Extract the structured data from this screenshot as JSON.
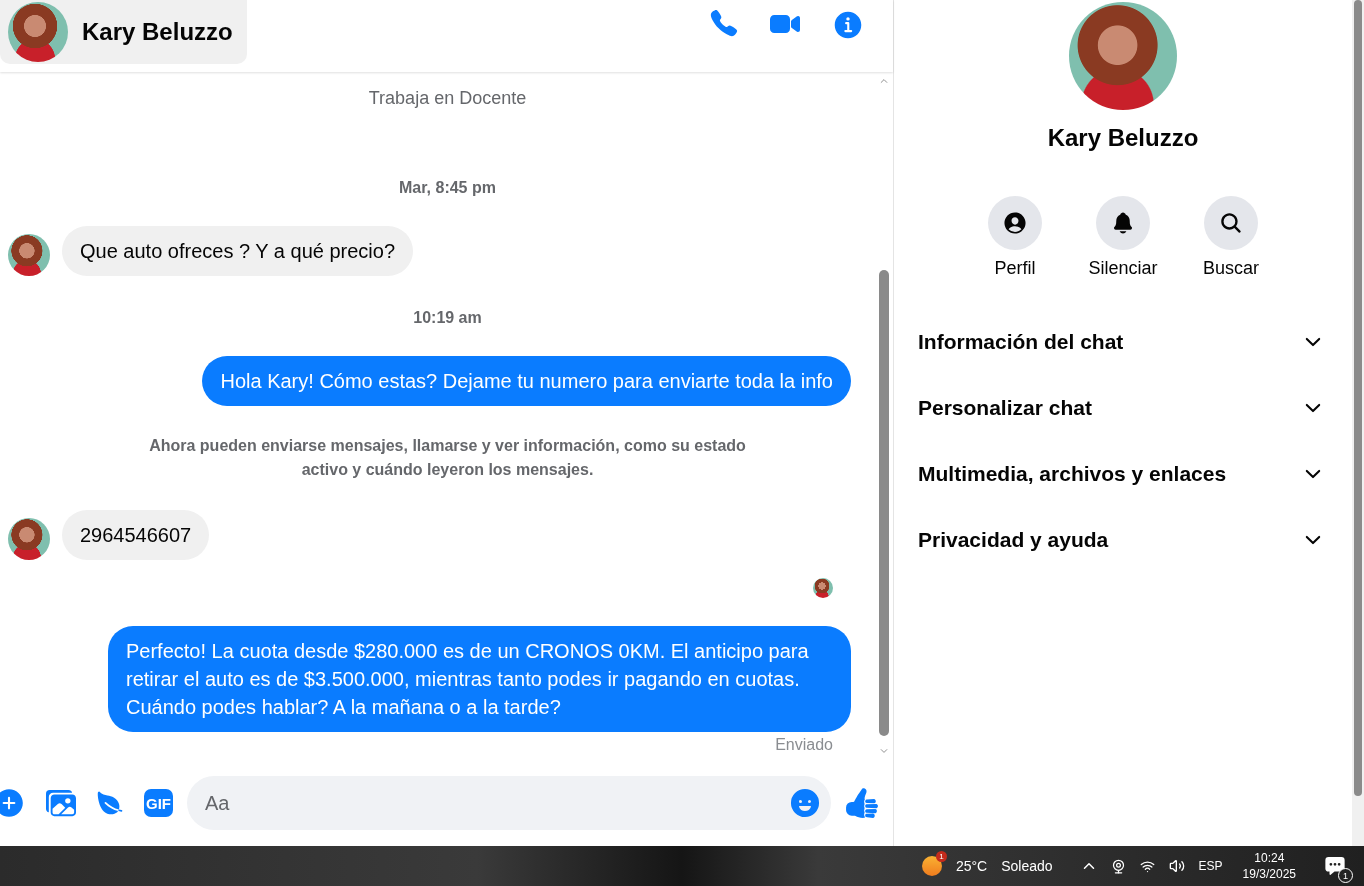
{
  "header": {
    "name": "Kary Beluzzo"
  },
  "chat": {
    "profile_info": "Trabaja en Docente",
    "messages": [
      {
        "kind": "timestamp",
        "text": "Mar, 8:45 pm"
      },
      {
        "kind": "incoming",
        "text": "Que auto ofreces ? Y a qué precio?"
      },
      {
        "kind": "timestamp",
        "text": "10:19 am"
      },
      {
        "kind": "outgoing",
        "text": "Hola Kary! Cómo estas? Dejame tu numero para enviarte toda la info"
      },
      {
        "kind": "notice",
        "text": "Ahora pueden enviarse mensajes, llamarse y ver información, como su estado activo y cuándo leyeron los mensajes."
      },
      {
        "kind": "incoming",
        "text": "2964546607"
      },
      {
        "kind": "seen"
      },
      {
        "kind": "outgoing",
        "text": "Perfecto! La cuota desde $280.000 es de un CRONOS 0KM. El anticipo para retirar el auto es de $3.500.000, mientras tanto podes ir pagando en cuotas. Cuándo podes hablar? A la mañana o a la tarde?"
      },
      {
        "kind": "status",
        "text": "Enviado"
      }
    ]
  },
  "composer": {
    "gif_label": "GIF",
    "placeholder": "Aa"
  },
  "side_panel": {
    "name": "Kary Beluzzo",
    "actions": [
      {
        "kind": "profile",
        "label": "Perfil"
      },
      {
        "kind": "mute",
        "label": "Silenciar"
      },
      {
        "kind": "search",
        "label": "Buscar"
      }
    ],
    "sections": [
      {
        "label": "Información del chat",
        "expanded": false
      },
      {
        "label": "Personalizar chat",
        "expanded": false
      },
      {
        "label": "Multimedia, archivos y enlaces",
        "expanded": false
      },
      {
        "label": "Privacidad y ayuda",
        "expanded": false
      }
    ]
  },
  "taskbar": {
    "weather_badge": "1",
    "temperature": "25°C",
    "weather": "Soleado",
    "language": "ESP",
    "time": "10:24",
    "date": "19/3/2025",
    "notifications": "1"
  }
}
